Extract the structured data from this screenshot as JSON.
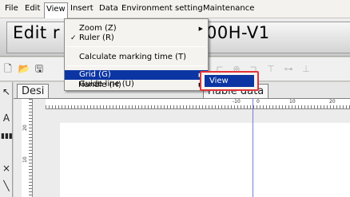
{
  "menubar": {
    "items": [
      "File",
      "Edit",
      "View",
      "Insert",
      "Data",
      "Environment setting",
      "Maintenance"
    ],
    "open_item": "View"
  },
  "title": {
    "left": "Edit r",
    "right": "00H-V1"
  },
  "view_menu": {
    "items": [
      {
        "label": "Zoom (Z)",
        "checked": false,
        "submenu": true
      },
      {
        "label": "Ruler (R)",
        "checked": true,
        "submenu": false
      },
      {
        "label": "Calculate marking time (T)",
        "checked": false,
        "submenu": false
      },
      {
        "label": "Grid (G)",
        "checked": false,
        "submenu": true,
        "highlighted": true
      },
      {
        "label": "Guide line (U)",
        "checked": false,
        "submenu": true
      },
      {
        "label": "Handle (H)",
        "checked": false,
        "submenu": true
      }
    ],
    "check_mark": "✓",
    "submenu_arrow": "▶"
  },
  "grid_submenu": {
    "items": [
      "View"
    ],
    "highlight_color": "#e3333a"
  },
  "tabs": {
    "first": "Desi",
    "second": "riable data"
  },
  "ruler": {
    "h_labels": [
      "-10",
      "0",
      "10",
      "20"
    ],
    "v_labels": [
      "20",
      "10"
    ]
  },
  "toolbar": {
    "icons": [
      "new-file",
      "open-folder",
      "save",
      "align-left",
      "align-center",
      "align-right",
      "align-top",
      "align-middle",
      "align-bottom"
    ]
  },
  "colors": {
    "menu_highlight": "#0b35a3",
    "guide_line": "#6f7fd8",
    "callout_border": "#e3333a"
  }
}
